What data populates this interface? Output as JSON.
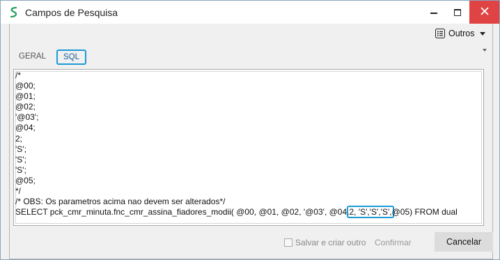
{
  "window": {
    "title": "Campos de Pesquisa",
    "close_color": "#e04343"
  },
  "toolbar": {
    "outros_label": "Outros"
  },
  "tabs": [
    {
      "label": "GERAL",
      "active": false
    },
    {
      "label": "SQL",
      "active": true
    }
  ],
  "editor": {
    "lines_before": "/*\n@00;\n@01;\n@02;\n'@03';\n@04;\n2;\n'S';\n'S';\n'S';\n@05;\n*/\n/* OBS: Os parametros acima nao devem ser alterados*/\n",
    "select_prefix": "SELECT pck_cmr_minuta.fnc_cmr_assina_fiadores_modii( @00, @01, @02, '@03', @04,",
    "select_highlight": "2, 'S','S','S',",
    "select_suffix": "@05) FROM dual"
  },
  "footer": {
    "save_create_label": "Salvar e criar outro",
    "confirm_label": "Confirmar",
    "cancel_label": "Cancelar"
  },
  "colors": {
    "accent": "#1b9ad6",
    "border": "#8aa6c1"
  }
}
